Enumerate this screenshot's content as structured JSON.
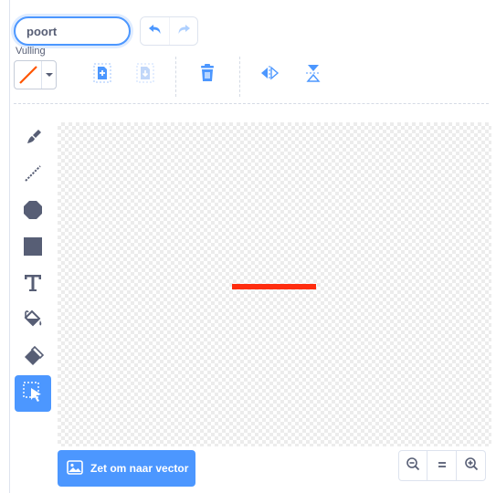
{
  "costume": {
    "name_value": "poort",
    "name_placeholder": ""
  },
  "toolbar": {
    "fill_label": "Vulling",
    "fill_color": "#ff2d0f",
    "accent_color": "#4c97ff",
    "icons": {
      "undo": "undo-icon",
      "redo": "redo-icon",
      "group": "group-icon",
      "ungroup": "ungroup-icon",
      "delete": "trash-icon",
      "flip_horizontal": "flip-horizontal-icon",
      "flip_vertical": "flip-vertical-icon"
    }
  },
  "tools": [
    {
      "name": "brush",
      "icon": "brush-icon",
      "selected": false
    },
    {
      "name": "line",
      "icon": "line-icon",
      "selected": false
    },
    {
      "name": "circle",
      "icon": "circle-icon",
      "selected": false
    },
    {
      "name": "rectangle",
      "icon": "rectangle-icon",
      "selected": false
    },
    {
      "name": "text",
      "icon": "text-icon",
      "selected": false
    },
    {
      "name": "fill",
      "icon": "fill-bucket-icon",
      "selected": false
    },
    {
      "name": "eraser",
      "icon": "eraser-icon",
      "selected": false
    },
    {
      "name": "select",
      "icon": "select-icon",
      "selected": true
    }
  ],
  "canvas": {
    "shape_color": "#ff2d0f"
  },
  "footer": {
    "convert_label": "Zet om naar vector",
    "zoom_out_icon": "zoom-out-icon",
    "zoom_reset_icon": "zoom-reset-icon",
    "zoom_in_icon": "zoom-in-icon"
  }
}
